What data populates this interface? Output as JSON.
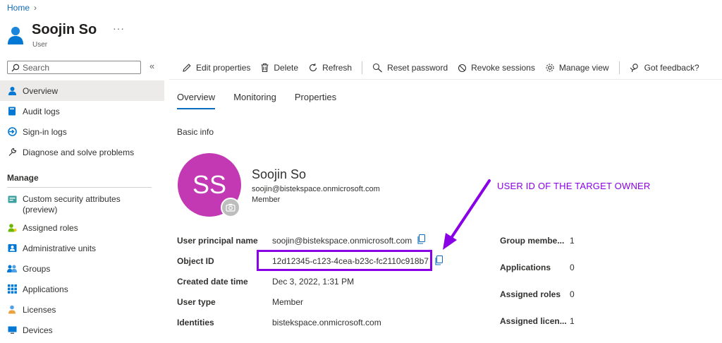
{
  "breadcrumb": {
    "home": "Home"
  },
  "header": {
    "title": "Soojin So",
    "subtitle": "User",
    "more": "···"
  },
  "search": {
    "placeholder": "Search"
  },
  "sidebar": {
    "items": [
      {
        "label": "Overview",
        "icon": "person-icon"
      },
      {
        "label": "Audit logs",
        "icon": "book-icon"
      },
      {
        "label": "Sign-in logs",
        "icon": "sign-in-icon"
      },
      {
        "label": "Diagnose and solve problems",
        "icon": "wrench-icon"
      }
    ],
    "manage_heading": "Manage",
    "manage_items": [
      {
        "label": "Custom security attributes (preview)",
        "icon": "attributes-icon"
      },
      {
        "label": "Assigned roles",
        "icon": "roles-icon"
      },
      {
        "label": "Administrative units",
        "icon": "admin-units-icon"
      },
      {
        "label": "Groups",
        "icon": "groups-icon"
      },
      {
        "label": "Applications",
        "icon": "apps-grid-icon"
      },
      {
        "label": "Licenses",
        "icon": "license-icon"
      },
      {
        "label": "Devices",
        "icon": "device-icon"
      }
    ]
  },
  "toolbar": {
    "edit": "Edit properties",
    "delete": "Delete",
    "refresh": "Refresh",
    "reset_password": "Reset password",
    "revoke": "Revoke sessions",
    "manage_view": "Manage view",
    "feedback": "Got feedback?"
  },
  "tabs": [
    "Overview",
    "Monitoring",
    "Properties"
  ],
  "basic_info": {
    "heading": "Basic info",
    "avatar_initials": "SS",
    "name": "Soojin So",
    "email": "soojin@bistekspace.onmicrosoft.com",
    "type": "Member"
  },
  "properties": [
    {
      "label": "User principal name",
      "value": "soojin@bistekspace.onmicrosoft.com"
    },
    {
      "label": "Object ID",
      "value": "12d12345-c123-4cea-b23c-fc2110c918b7"
    },
    {
      "label": "Created date time",
      "value": "Dec 3, 2022, 1:31 PM"
    },
    {
      "label": "User type",
      "value": "Member"
    },
    {
      "label": "Identities",
      "value": "bistekspace.onmicrosoft.com"
    }
  ],
  "stats": [
    {
      "label": "Group membe...",
      "value": "1"
    },
    {
      "label": "Applications",
      "value": "0"
    },
    {
      "label": "Assigned roles",
      "value": "0"
    },
    {
      "label": "Assigned licen...",
      "value": "1"
    }
  ],
  "annotation": {
    "text": "USER ID OF THE TARGET OWNER"
  },
  "colors": {
    "accent": "#0f6cbd",
    "avatar": "#c239b3",
    "annotation": "#8a00e6"
  }
}
